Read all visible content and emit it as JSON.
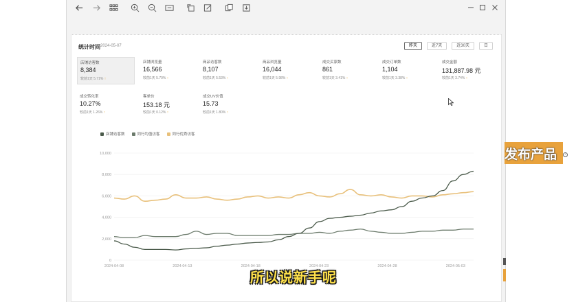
{
  "toolbar": {
    "icons": [
      "back-icon",
      "forward-icon",
      "grid-icon",
      "zoom-in-icon",
      "zoom-out-icon",
      "fit-page-icon",
      "rotate-icon",
      "edit-icon",
      "copy-icon",
      "save-icon"
    ]
  },
  "header": {
    "title": "统计时间",
    "date": "2024-05-07",
    "ranges": [
      "昨天",
      "近7天",
      "近30天",
      "日"
    ],
    "active_range": 0
  },
  "cards": [
    {
      "label": "店铺访客数",
      "value": "8,384",
      "compare": "较前1天 5.71%",
      "selected": true
    },
    {
      "label": "店铺浏览量",
      "value": "16,566",
      "compare": "较前1天 5.70%",
      "selected": false
    },
    {
      "label": "商品访客数",
      "value": "8,107",
      "compare": "较前1天 5.53%",
      "selected": false
    },
    {
      "label": "商品浏览量",
      "value": "16,044",
      "compare": "较前1天 5.98%",
      "selected": false
    },
    {
      "label": "成交买家数",
      "value": "861",
      "compare": "较前1天 3.41%",
      "selected": false
    },
    {
      "label": "成交订单数",
      "value": "1,104",
      "compare": "较前1天 3.38%",
      "selected": false
    },
    {
      "label": "成交金额",
      "value": "131,887.98 元",
      "compare": "较前1天 3.74%",
      "selected": false
    },
    {
      "label": "成交转化率",
      "value": "10.27%",
      "compare": "较前1天 1.26%",
      "selected": false
    },
    {
      "label": "客单价",
      "value": "153.18 元",
      "compare": "较前1天 0.12%",
      "selected": false
    },
    {
      "label": "成交UV价值",
      "value": "15.73",
      "compare": "较前1天 1.80%",
      "selected": false
    }
  ],
  "chart_data": {
    "type": "line",
    "x": [
      "2024-04-08",
      "2024-04-13",
      "2024-04-18",
      "2024-04-23",
      "2024-04-28",
      "2024-05-03"
    ],
    "ylim": [
      0,
      10000
    ],
    "yticks": [
      "0",
      "2,000",
      "4,000",
      "6,000",
      "8,000",
      "10,000"
    ],
    "series": [
      {
        "name": "店铺访客数",
        "color": "#4a5a4a",
        "values": [
          1800,
          1500,
          1200,
          1000,
          1000,
          1000,
          950,
          1050,
          1100,
          1150,
          1300,
          1400,
          1500,
          1600,
          1650,
          1700,
          1900,
          2200,
          2500,
          3000,
          3600,
          3900,
          4000,
          4100,
          4200,
          4400,
          4600,
          4700,
          5000,
          5500,
          5800,
          6000,
          6500,
          7400,
          8000,
          8300
        ]
      },
      {
        "name": "同行均值访客",
        "color": "#6b7a6b",
        "values": [
          2200,
          2100,
          2100,
          2300,
          2200,
          2200,
          2200,
          2400,
          2700,
          2400,
          2500,
          2500,
          2300,
          2300,
          2300,
          2300,
          2400,
          2400,
          2500,
          2500,
          2600,
          2500,
          2700,
          2800,
          2900,
          2700,
          2600,
          2500,
          2500,
          2600,
          2700,
          2700,
          2800,
          2800,
          2900,
          2900
        ]
      },
      {
        "name": "同行优秀访客",
        "color": "#e8c07a",
        "values": [
          5800,
          5700,
          6000,
          5500,
          5600,
          5700,
          6100,
          5800,
          5800,
          5900,
          5700,
          5600,
          5700,
          5900,
          6000,
          5800,
          5900,
          5800,
          6100,
          6300,
          6000,
          5900,
          6200,
          6600,
          6100,
          6000,
          6100,
          5900,
          5800,
          6000,
          6000,
          5900,
          6100,
          6200,
          6300,
          6400
        ]
      }
    ],
    "grid": true,
    "legend": "top-left"
  },
  "cursor": "arrow-cursor-icon",
  "side_tag": "发布产品",
  "subtitle": "所以说新手呢"
}
